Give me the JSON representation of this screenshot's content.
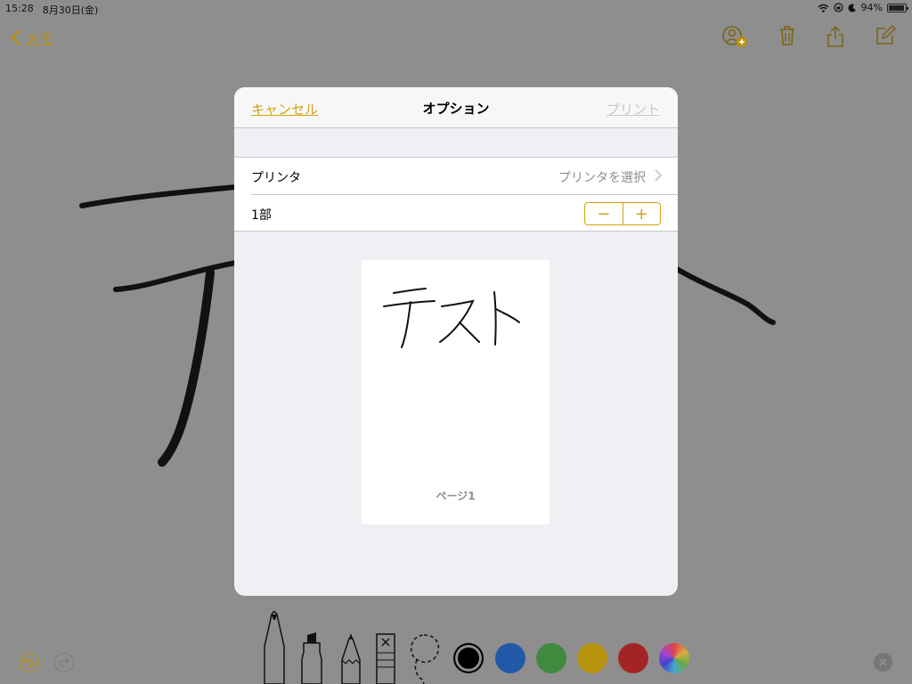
{
  "status_bar": {
    "time": "15:28",
    "date": "8月30日(金)",
    "battery": "94%"
  },
  "note_nav": {
    "back_label": "メモ"
  },
  "print_dialog": {
    "cancel_label": "キャンセル",
    "title": "オプション",
    "print_label": "プリント",
    "printer_label": "プリンタ",
    "printer_value": "プリンタを選択",
    "copies_label": "1部",
    "minus_label": "−",
    "plus_label": "+",
    "page_label": "ページ1"
  },
  "toolbar": {
    "colors": {
      "black": "#000000",
      "blue": "#2158a8",
      "green": "#3f8a3f",
      "yellow": "#b8950f",
      "red": "#a42424"
    },
    "accent": "#d4a017"
  }
}
